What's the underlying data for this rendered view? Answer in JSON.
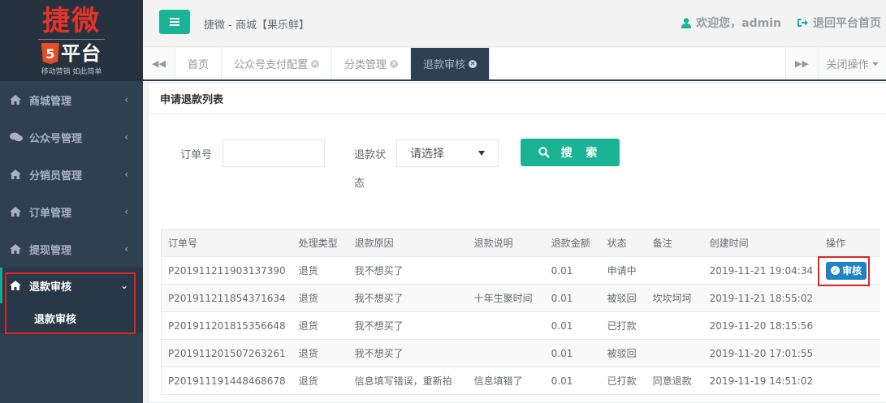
{
  "sidebar": {
    "logo_top": "捷微",
    "logo_h5": "5",
    "logo_mid": "平台",
    "logo_sub": "移动营销 如此简单",
    "items": [
      {
        "label": "商城管理"
      },
      {
        "label": "公众号管理"
      },
      {
        "label": "分销员管理"
      },
      {
        "label": "订单管理"
      },
      {
        "label": "提现管理"
      }
    ],
    "active_group": {
      "label": "退款审核",
      "sub_label": "退款审核"
    }
  },
  "topbar": {
    "title": "捷微 - 商城【果乐鲜】",
    "welcome": "欢迎您，admin",
    "back": "退回平台首页"
  },
  "tabs": {
    "items": [
      {
        "label": "首页"
      },
      {
        "label": "公众号支付配置"
      },
      {
        "label": "分类管理"
      },
      {
        "label": "退款审核"
      }
    ],
    "close_ops": "关闭操作"
  },
  "panel": {
    "title": "申请退款列表",
    "order_label": "订单号",
    "status_label_1": "退款状",
    "status_label_2": "态",
    "select_value": "请选择",
    "search_label": "搜 索"
  },
  "table": {
    "headers": [
      "订单号",
      "处理类型",
      "退款原因",
      "退款说明",
      "退款金额",
      "状态",
      "备注",
      "创建时间",
      "操作"
    ],
    "rows": [
      {
        "order": "P201911211903137390",
        "type": "退货",
        "reason": "我不想买了",
        "desc": "",
        "amount": "0.01",
        "status": "申请中",
        "remark": "",
        "time": "2019-11-21 19:04:34",
        "action": "审核"
      },
      {
        "order": "P201911211854371634",
        "type": "退货",
        "reason": "我不想买了",
        "desc": "十年生聚时间",
        "amount": "0.01",
        "status": "被驳回",
        "remark": "坎坎坷坷",
        "time": "2019-11-21 18:55:02",
        "action": ""
      },
      {
        "order": "P201911201815356648",
        "type": "退货",
        "reason": "我不想买了",
        "desc": "",
        "amount": "0.01",
        "status": "已打款",
        "remark": "",
        "time": "2019-11-20 18:15:56",
        "action": ""
      },
      {
        "order": "P201911201507263261",
        "type": "退货",
        "reason": "我不想买了",
        "desc": "",
        "amount": "0.01",
        "status": "被驳回",
        "remark": "",
        "time": "2019-11-20 17:01:55",
        "action": ""
      },
      {
        "order": "P201911191448468678",
        "type": "退货",
        "reason": "信息填写错误，重新拍",
        "desc": "信息填错了",
        "amount": "0.01",
        "status": "已打款",
        "remark": "同意退款",
        "time": "2019-11-19 14:51:02",
        "action": ""
      }
    ]
  },
  "colors": {
    "accent": "#1ab394",
    "sidebar": "#2f4050",
    "button_blue": "#1c84c6",
    "highlight": "#e02424"
  }
}
